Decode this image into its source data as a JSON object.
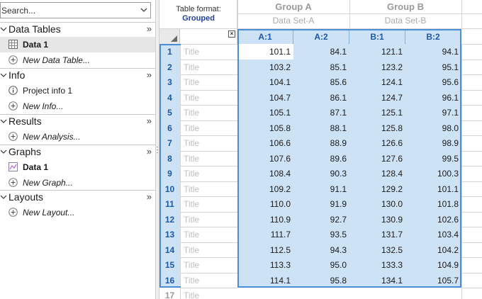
{
  "sidebar": {
    "search_placeholder": "Search...",
    "sections": [
      {
        "title": "Data Tables",
        "items": [
          {
            "label": "Data 1"
          },
          {
            "label": "New Data Table..."
          }
        ]
      },
      {
        "title": "Info",
        "items": [
          {
            "label": "Project info 1"
          },
          {
            "label": "New Info..."
          }
        ]
      },
      {
        "title": "Results",
        "items": [
          {
            "label": "New Analysis..."
          }
        ]
      },
      {
        "title": "Graphs",
        "items": [
          {
            "label": "Data 1"
          },
          {
            "label": "New Graph..."
          }
        ]
      },
      {
        "title": "Layouts",
        "items": [
          {
            "label": "New Layout..."
          }
        ]
      }
    ],
    "more_glyph": "»"
  },
  "table": {
    "format_label": "Table format:",
    "format_value": "Grouped",
    "groups": [
      {
        "title": "Group A",
        "subtitle": "Data Set-A",
        "columns": [
          "A:1",
          "A:2"
        ]
      },
      {
        "title": "Group B",
        "subtitle": "Data Set-B",
        "columns": [
          "B:1",
          "B:2"
        ]
      }
    ],
    "title_placeholder": "Title",
    "close_glyph": "×",
    "rows": [
      {
        "num": "1",
        "values": [
          "101.1",
          "84.1",
          "121.1",
          "94.1"
        ]
      },
      {
        "num": "2",
        "values": [
          "103.2",
          "85.1",
          "123.2",
          "95.1"
        ]
      },
      {
        "num": "3",
        "values": [
          "104.1",
          "85.6",
          "124.1",
          "95.6"
        ]
      },
      {
        "num": "4",
        "values": [
          "104.7",
          "86.1",
          "124.7",
          "96.1"
        ]
      },
      {
        "num": "5",
        "values": [
          "105.1",
          "87.1",
          "125.1",
          "97.1"
        ]
      },
      {
        "num": "6",
        "values": [
          "105.8",
          "88.1",
          "125.8",
          "98.0"
        ]
      },
      {
        "num": "7",
        "values": [
          "106.6",
          "88.9",
          "126.6",
          "98.9"
        ]
      },
      {
        "num": "8",
        "values": [
          "107.6",
          "89.6",
          "127.6",
          "99.5"
        ]
      },
      {
        "num": "9",
        "values": [
          "108.4",
          "90.3",
          "128.4",
          "100.3"
        ]
      },
      {
        "num": "10",
        "values": [
          "109.2",
          "91.1",
          "129.2",
          "101.1"
        ]
      },
      {
        "num": "11",
        "values": [
          "110.0",
          "91.9",
          "130.0",
          "101.8"
        ]
      },
      {
        "num": "12",
        "values": [
          "110.9",
          "92.7",
          "130.9",
          "102.6"
        ]
      },
      {
        "num": "13",
        "values": [
          "111.7",
          "93.5",
          "131.7",
          "103.4"
        ]
      },
      {
        "num": "14",
        "values": [
          "112.5",
          "94.3",
          "132.5",
          "104.2"
        ]
      },
      {
        "num": "15",
        "values": [
          "113.3",
          "95.0",
          "133.3",
          "104.9"
        ]
      },
      {
        "num": "16",
        "values": [
          "114.1",
          "95.8",
          "134.1",
          "105.7"
        ]
      },
      {
        "num": "17",
        "values": [
          "",
          "",
          "",
          ""
        ]
      }
    ]
  },
  "colors": {
    "selection": "#cde2f5",
    "selection_border": "#4a8fd6",
    "header_text": "#1d57a8",
    "format_value": "#1f3f9f"
  }
}
